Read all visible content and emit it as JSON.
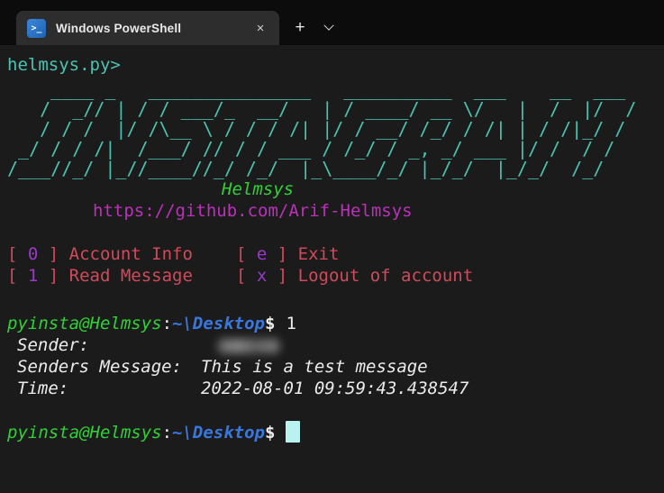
{
  "window": {
    "tab_title": "Windows PowerShell",
    "close_icon": "×",
    "new_tab_icon": "+",
    "ps_icon_glyph": ">_"
  },
  "terminal": {
    "script_prompt": "helmsys.py>",
    "banner": {
      "lines": [
        "    ____ _   _______________   __________  ___    __  ___",
        "   /  _// | / / ___/_  __/   | / ____/ __ \\/   |  /  |/  /",
        "   / / /  |/ /\\__ \\ / / / /| |/ / __/ /_/ / /| | / /|_/ /",
        " _/ / / /|  /___/ // / / ___ / /_/ / _, _/ ___ |/ /  / /",
        "/___//_/ |_//____//_/ /_/  |_\\____/_/ |_/_/  |_/_/  /_/"
      ],
      "caption": "Helmsys",
      "url": "https://github.com/Arif-Helmsys"
    },
    "menu": {
      "bracket_open": "[ ",
      "bracket_close": " ] ",
      "items": [
        {
          "key": "0",
          "label": "Account Info"
        },
        {
          "key": "e",
          "label": "Exit"
        },
        {
          "key": "1",
          "label": "Read Message"
        },
        {
          "key": "x",
          "label": "Logout of account"
        }
      ]
    },
    "prompt": {
      "user": "pyinsta@Helmsys",
      "separator": ":",
      "path": "~\\Desktop",
      "symbol": "$"
    },
    "command": "1",
    "message": {
      "sender_label": "Sender:",
      "message_label": "Senders Message:",
      "message_value": "This is a test message",
      "time_label": "Time:",
      "time_value": "2022-08-01 09:59:43.438547"
    },
    "colors": {
      "background": "#1b1b1b",
      "teal": "#4cc2b0",
      "green": "#30d136",
      "magenta": "#bd2fbd",
      "red": "#d14a5c",
      "purple": "#9d36cf",
      "blue": "#3a77dd",
      "cursor": "#b9f3ef"
    }
  }
}
